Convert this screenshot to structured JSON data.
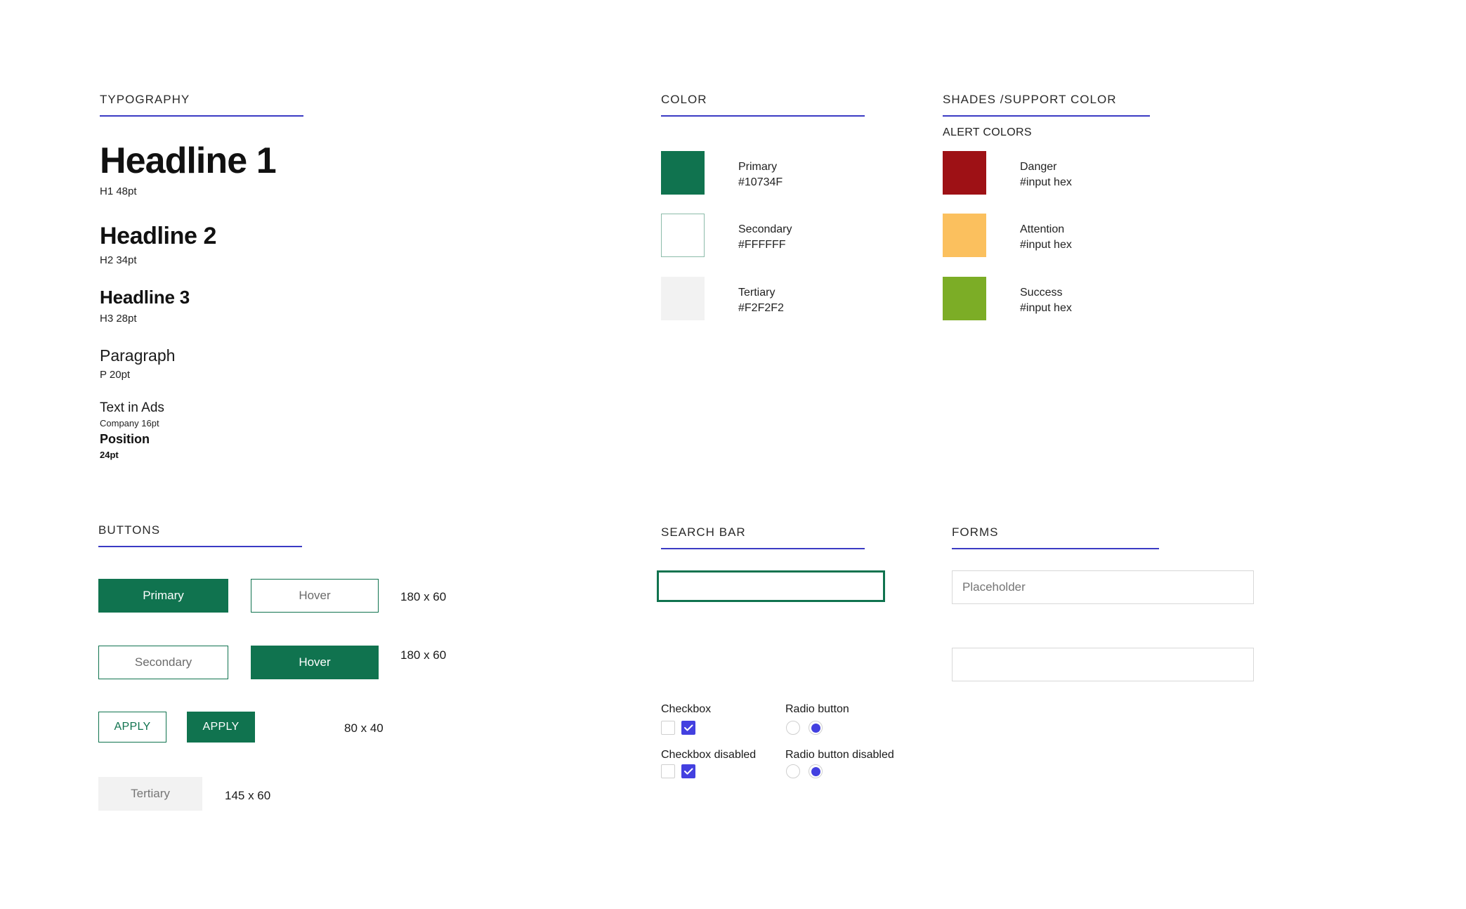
{
  "sections": {
    "typography": {
      "title": "TYPOGRAPHY"
    },
    "color": {
      "title": "COLOR"
    },
    "shades": {
      "title": "SHADES /SUPPORT COLOR",
      "subtitle": "ALERT COLORS"
    },
    "buttons": {
      "title": "BUTTONS"
    },
    "search": {
      "title": "SEARCH BAR"
    },
    "forms": {
      "title": "FORMS"
    }
  },
  "typography": {
    "specimens": [
      {
        "sample": "Headline 1",
        "label": "H1 48pt"
      },
      {
        "sample": "Headline 2",
        "label": "H2 34pt"
      },
      {
        "sample": "Headline 3",
        "label": "H3 28pt"
      },
      {
        "sample": "Paragraph",
        "label": "P 20pt"
      },
      {
        "sample": "Text in Ads",
        "label": "Company 16pt"
      },
      {
        "sample": "Position",
        "label": "24pt"
      }
    ]
  },
  "colors": {
    "swatches": [
      {
        "name": "Primary",
        "hex": "#10734F",
        "fill": "#10734F",
        "border": "none"
      },
      {
        "name": "Secondary",
        "hex": "#FFFFFF",
        "fill": "#FFFFFF",
        "border": "#8cbba9"
      },
      {
        "name": "Tertiary",
        "hex": "#F2F2F2",
        "fill": "#F2F2F2",
        "border": "none"
      }
    ]
  },
  "alert_colors": {
    "swatches": [
      {
        "name": "Danger",
        "hex": "#input hex",
        "fill": "#9e1115"
      },
      {
        "name": "Attention",
        "hex": "#input hex",
        "fill": "#fbc05e"
      },
      {
        "name": "Success",
        "hex": "#input hex",
        "fill": "#7cad26"
      }
    ]
  },
  "buttons": {
    "items": [
      {
        "label": "Primary",
        "size": ""
      },
      {
        "label": "Hover",
        "size": "180 x 60"
      },
      {
        "label": "Secondary",
        "size": ""
      },
      {
        "label": "Hover",
        "size": "180 x 60"
      },
      {
        "label": "APPLY",
        "size": ""
      },
      {
        "label": "APPLY",
        "size": "80 x 40"
      },
      {
        "label": "Tertiary",
        "size": "145 x 60"
      }
    ]
  },
  "search": {
    "value": "",
    "placeholder": ""
  },
  "forms": {
    "field1_placeholder": "Placeholder",
    "field1_value": "",
    "field2_placeholder": "",
    "field2_value": ""
  },
  "controls": {
    "checkbox_label": "Checkbox",
    "checkbox_disabled_label": "Checkbox disabled",
    "radio_label": "Radio button",
    "radio_disabled_label": "Radio button disabled"
  },
  "theme": {
    "rule": "#3b3bc4",
    "primary": "#10734F",
    "control_accent": "#4340e0"
  }
}
